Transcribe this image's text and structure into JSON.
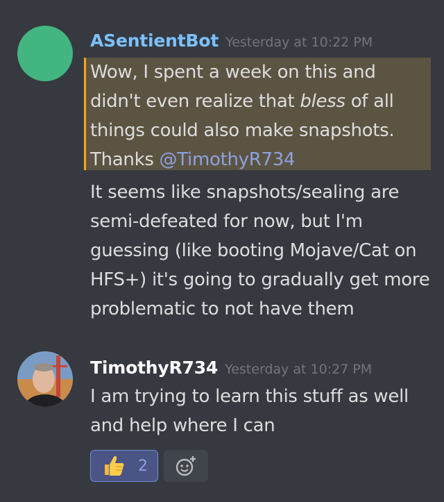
{
  "messages": [
    {
      "username": "ASentientBot",
      "username_color": "#7cc0ff",
      "timestamp": "Yesterday at 10:22 PM",
      "avatar": "green-circle",
      "quote": {
        "before": "Wow, I spent a week on this and didn't even realize that ",
        "italic": "bless",
        "after": " of all things could also make snapshots. Thanks ",
        "mention": "@TimothyR734"
      },
      "text": "It seems like snapshots/sealing are semi-defeated for now, but I'm guessing (like booting Mojave/Cat on HFS+) it's going to gradually get more problematic to not have them"
    },
    {
      "username": "TimothyR734",
      "username_color": "#ffffff",
      "timestamp": "Yesterday at 10:27 PM",
      "avatar": "profile-photo",
      "text": "I am trying to learn this stuff as well and help where I can"
    }
  ],
  "reactions": [
    {
      "emoji": "thumbs-up-icon",
      "count": "2"
    },
    {
      "emoji": "add-reaction-icon"
    }
  ]
}
